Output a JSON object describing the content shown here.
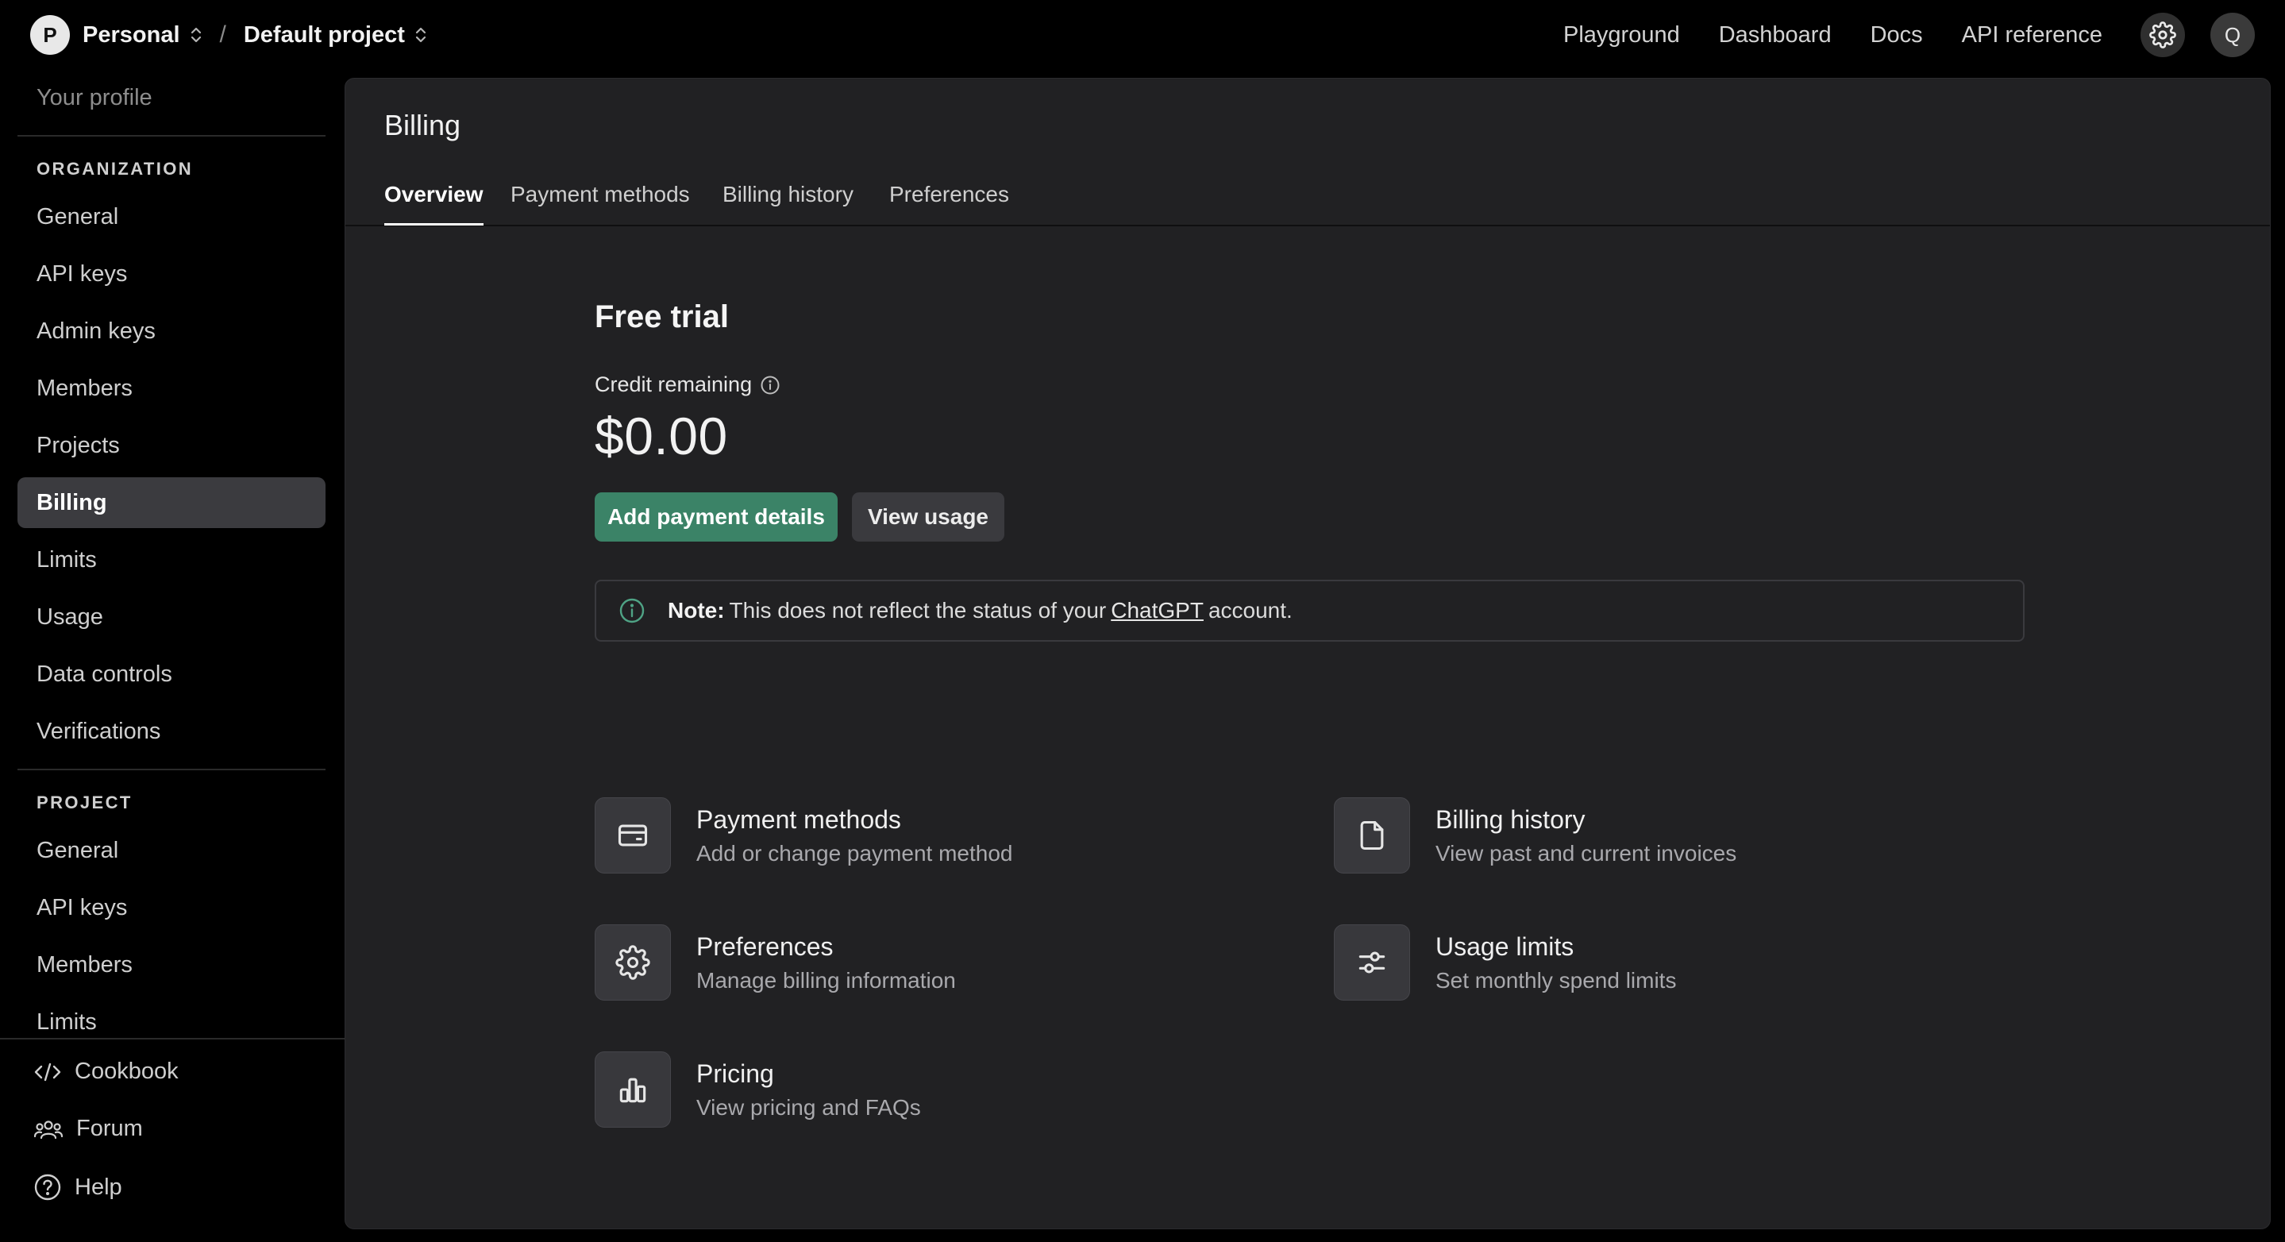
{
  "topbar": {
    "org_initial": "P",
    "org_name": "Personal",
    "separator": "/",
    "project_name": "Default project",
    "nav": [
      "Playground",
      "Dashboard",
      "Docs",
      "API reference"
    ],
    "user_initial": "Q"
  },
  "sidebar": {
    "profile": "Your profile",
    "org_section": "ORGANIZATION",
    "org_items": [
      "General",
      "API keys",
      "Admin keys",
      "Members",
      "Projects",
      "Billing",
      "Limits",
      "Usage",
      "Data controls",
      "Verifications"
    ],
    "active_item": "Billing",
    "project_section": "PROJECT",
    "project_items": [
      "General",
      "API keys",
      "Members",
      "Limits"
    ],
    "bottom": [
      {
        "label": "Cookbook",
        "icon": "code-icon"
      },
      {
        "label": "Forum",
        "icon": "people-icon"
      },
      {
        "label": "Help",
        "icon": "help-icon"
      }
    ]
  },
  "main": {
    "title": "Billing",
    "tabs": [
      {
        "label": "Overview",
        "active": true
      },
      {
        "label": "Payment methods",
        "active": false
      },
      {
        "label": "Billing history",
        "active": false
      },
      {
        "label": "Preferences",
        "active": false
      }
    ],
    "plan": "Free trial",
    "credit_label": "Credit remaining",
    "credit_amount": "$0.00",
    "primary_button": "Add payment details",
    "secondary_button": "View usage",
    "note": {
      "bold": "Note:",
      "text_before": "This does not reflect the status of your",
      "link": "ChatGPT",
      "text_after": "account."
    },
    "cards": [
      {
        "title": "Payment methods",
        "subtitle": "Add or change payment method",
        "icon": "credit-card-icon"
      },
      {
        "title": "Billing history",
        "subtitle": "View past and current invoices",
        "icon": "document-icon"
      },
      {
        "title": "Preferences",
        "subtitle": "Manage billing information",
        "icon": "gear-icon"
      },
      {
        "title": "Usage limits",
        "subtitle": "Set monthly spend limits",
        "icon": "sliders-icon"
      },
      {
        "title": "Pricing",
        "subtitle": "View pricing and FAQs",
        "icon": "bar-chart-icon"
      }
    ]
  },
  "colors": {
    "page_bg": "#000000",
    "panel_bg": "#212123",
    "accent_green": "#3b8367",
    "active_item_bg": "#3b3b3f"
  }
}
